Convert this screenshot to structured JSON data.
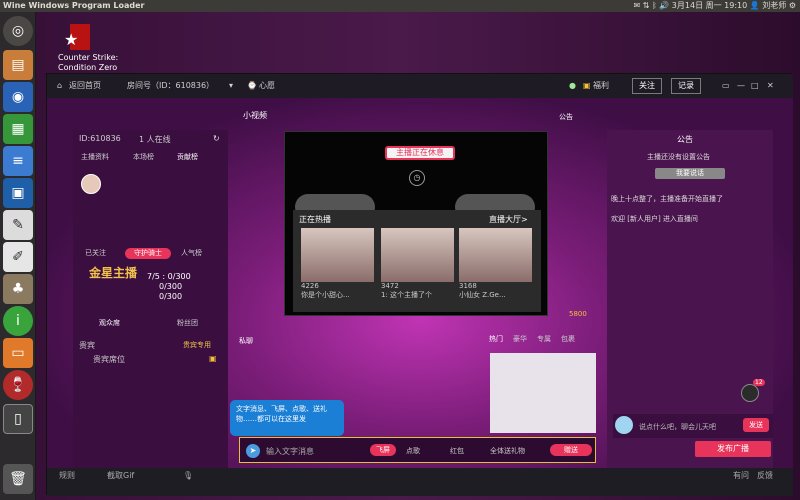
{
  "topbar": {
    "title": "Wine Windows Program Loader",
    "clock": "3月14日 周一 19:10",
    "user": "刘老师"
  },
  "desktop": {
    "app_icon_label_1": "Counter Strike:",
    "app_icon_label_2": "Condition Zero"
  },
  "launcher": {
    "icons": [
      "dash-icon",
      "files-icon",
      "firefox-icon",
      "calc-icon",
      "writer-icon",
      "virtualbox-icon",
      "system-settings-icon",
      "text-editor-icon",
      "gimp-icon",
      "info-icon",
      "impress-icon",
      "wine-icon",
      "terminal-icon",
      "trash-icon"
    ]
  },
  "window": {
    "back": "返回首页",
    "room_info": "房间号（ID：610836）",
    "history": "心愿",
    "welfare": "福利",
    "btn_follow": "关注",
    "btn_record": "记录",
    "bottom_left": [
      "规则",
      "截取Gif"
    ],
    "bottom_right": [
      "有问",
      "反馈"
    ]
  },
  "left_panel": {
    "room_id": "ID:610836",
    "online": "1 人在线",
    "tabs": [
      "主播资料",
      "本场榜",
      "贡献榜"
    ],
    "subtabs": [
      "已关注",
      "守护骑士",
      "人气榜"
    ],
    "rank_title": "金星主播",
    "stat_1": "7/5 : 0/300",
    "stat_2": "0/300",
    "stat_3": "0/300",
    "bottom_tabs": [
      "观众席",
      "粉丝团"
    ],
    "audience_label": "贵宾",
    "audience_item": "贵宾席位",
    "audience_badge": "贵宾专用"
  },
  "video": {
    "tab_hint": "小视频",
    "banner": "主播正在休息",
    "now_playing": "正在热播",
    "more": "直播大厅>",
    "cards": [
      {
        "count": "4226",
        "caption": "你是个小甜心..."
      },
      {
        "count": "3472",
        "caption": "1: 这个主播了个"
      },
      {
        "count": "3168",
        "caption": "小仙女 Z.Ge..."
      }
    ]
  },
  "stage_mid": {
    "label_top": "公告",
    "notice_label": "私聊"
  },
  "right_panel": {
    "title": "公告",
    "line1": "主播还没有设置公告",
    "button": "我要说话",
    "line2": "晚上十点整了，主播准备开始直播了",
    "line3": "欢迎 [新人用户] 进入直播间"
  },
  "chat": {
    "tooltip": "文字消息、飞屏、点歌、送礼物……都可以在这里发",
    "input_placeholder": "输入文字消息",
    "btn_fly": "飞屏",
    "gift_label": "点歌",
    "hongbao": "红包",
    "count_label": "全体送礼物",
    "send": "赠送"
  },
  "gift_tabs": [
    "热门",
    "豪华",
    "专属",
    "包裹"
  ],
  "gift_price": "5800",
  "right_chat": {
    "placeholder": "说点什么吧，聊会儿天吧",
    "send": "发送",
    "broadcast": "发布广播"
  },
  "notif_count": "12"
}
